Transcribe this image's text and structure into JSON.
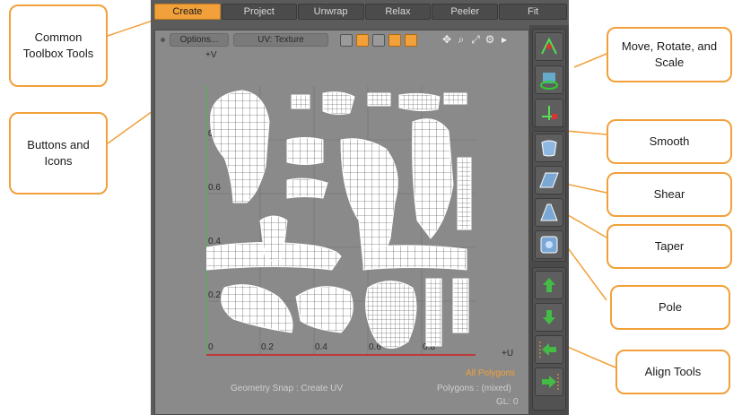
{
  "tabs": [
    {
      "label": "Create",
      "active": true
    },
    {
      "label": "Project",
      "active": false
    },
    {
      "label": "Unwrap",
      "active": false
    },
    {
      "label": "Relax",
      "active": false
    },
    {
      "label": "Peeler",
      "active": false
    },
    {
      "label": "Fit",
      "active": false
    }
  ],
  "viewport": {
    "options_label": "Options...",
    "uv_label": "UV: Texture",
    "axis_v": "+V",
    "axis_u": "+U",
    "tick_labels_v": [
      "0.8",
      "0.6",
      "0.4",
      "0.2",
      "0"
    ],
    "tick_labels_u": [
      "0.2",
      "0.4",
      "0.6",
      "0.8"
    ],
    "mode_icons": [
      "vertices-icon",
      "edges-icon",
      "polygons-icon",
      "items-icon",
      "materials-icon"
    ],
    "nav_icons": [
      "move-view-icon",
      "zoom-icon",
      "fit-icon",
      "gear-icon",
      "triangle-right-icon"
    ]
  },
  "status": {
    "selection": "All Polygons",
    "snap": "Geometry Snap : Create UV",
    "polygons": "Polygons : (mixed)",
    "gl": "GL: 0"
  },
  "toolbox": {
    "tools": [
      "move-icon",
      "rotate-icon",
      "scale-icon",
      "smooth-icon",
      "shear-icon",
      "taper-icon",
      "pole-icon",
      "align-up-icon",
      "align-down-icon",
      "align-left-icon",
      "align-right-icon"
    ]
  },
  "callouts": {
    "common_toolbox": "Common Toolbox Tools",
    "buttons_icons": "Buttons and Icons",
    "move_rotate_scale": "Move, Rotate, and Scale",
    "smooth": "Smooth",
    "shear": "Shear",
    "taper": "Taper",
    "pole": "Pole",
    "align": "Align Tools"
  },
  "colors": {
    "accent": "#f2a03a",
    "panel": "#5b5b5b",
    "viewport": "#8a8a8a",
    "axis_v": "#3dbf3d",
    "axis_u": "#d02020"
  }
}
